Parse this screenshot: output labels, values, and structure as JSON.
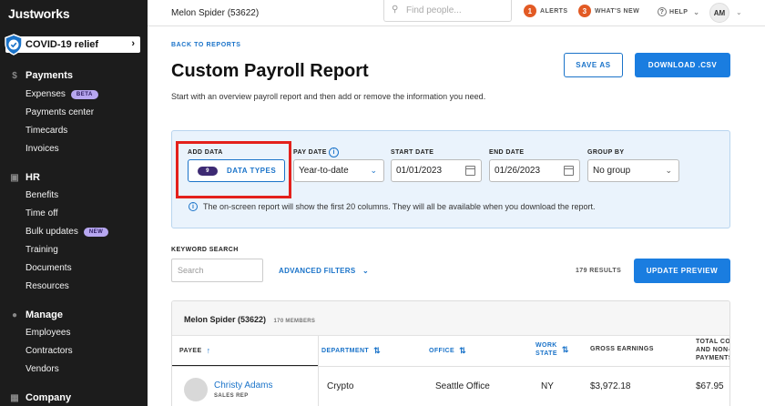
{
  "sidebar": {
    "logo": "Justworks",
    "covid": "COVID-19 relief",
    "sections": [
      {
        "label": "Payments",
        "icon": "dollar-icon"
      },
      {
        "label": "HR",
        "icon": "briefcase-icon"
      },
      {
        "label": "Manage",
        "icon": "people-icon"
      },
      {
        "label": "Company",
        "icon": "building-icon"
      }
    ],
    "items": {
      "expenses": "Expenses",
      "expenses_badge": "BETA",
      "payments_center": "Payments center",
      "timecards": "Timecards",
      "invoices": "Invoices",
      "benefits": "Benefits",
      "time_off": "Time off",
      "bulk_updates": "Bulk updates",
      "bulk_badge": "NEW",
      "training": "Training",
      "documents": "Documents",
      "resources": "Resources",
      "employees": "Employees",
      "contractors": "Contractors",
      "vendors": "Vendors"
    }
  },
  "topbar": {
    "company": "Melon Spider (53622)",
    "search_placeholder": "Find people...",
    "alerts_count": "1",
    "alerts_label": "ALERTS",
    "whats_new_count": "3",
    "whats_new_label": "WHAT'S NEW",
    "help_label": "HELP",
    "avatar": "AM"
  },
  "main": {
    "back": "BACK TO REPORTS",
    "title": "Custom Payroll Report",
    "subtitle": "Start with an overview payroll report and then add or remove the information you need.",
    "save_as": "SAVE AS",
    "download": "DOWNLOAD .CSV"
  },
  "filters": {
    "add_data_label": "ADD DATA",
    "data_types_count": "9",
    "data_types_label": "DATA TYPES",
    "pay_date_label": "PAY DATE",
    "pay_date_value": "Year-to-date",
    "start_date_label": "START DATE",
    "start_date_value": "01/01/2023",
    "end_date_label": "END DATE",
    "end_date_value": "01/26/2023",
    "group_by_label": "GROUP BY",
    "group_by_value": "No group",
    "info": "The on-screen report will show the first 20 columns. They will all be available when you download the report."
  },
  "search": {
    "label": "KEYWORD SEARCH",
    "placeholder": "Search",
    "advanced": "ADVANCED FILTERS",
    "results": "179 RESULTS",
    "update": "UPDATE PREVIEW"
  },
  "table": {
    "group_name": "Melon Spider (53622)",
    "members": "170 MEMBERS",
    "columns": {
      "payee": "PAYEE",
      "department": "DEPARTMENT",
      "office": "OFFICE",
      "work_state_1": "WORK",
      "work_state_2": "STATE",
      "gross": "GROSS EARNINGS",
      "total_1": "TOTAL CO",
      "total_2": "AND NON-",
      "total_3": "PAYMENTS"
    },
    "rows": [
      {
        "name": "Christy Adams",
        "role": "SALES REP",
        "department": "Crypto",
        "office": "Seattle Office",
        "state": "NY",
        "gross": "$3,972.18",
        "total": "$67.95"
      }
    ]
  }
}
